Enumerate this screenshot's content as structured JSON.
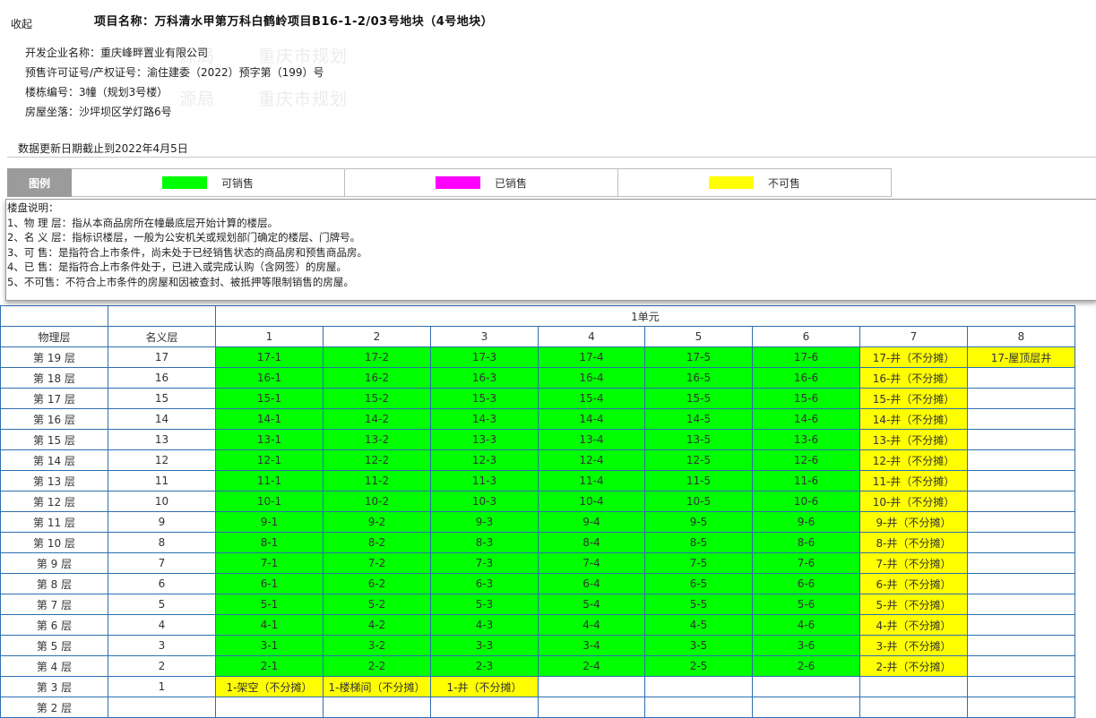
{
  "header": {
    "collapse_label": "收起",
    "project_name": "项目名称：万科清水甲第万科白鹤岭项目B16-1-2/03号地块（4号地块）",
    "developer": "开发企业名称：重庆峰畔置业有限公司",
    "license": "预售许可证号/产权证号：渝住建委（2022）预字第（199）号",
    "building": "楼栋编号：3幢（规划3号楼）",
    "address": "房屋坐落：沙坪坝区学灯路6号",
    "update_date": "数据更新日期截止到2022年4月5日",
    "watermarks": [
      "重庆市规划",
      "源局",
      "重庆市规划"
    ]
  },
  "legend": {
    "title": "图例",
    "items": [
      {
        "label": "可销售",
        "color": "#00ff00"
      },
      {
        "label": "已销售",
        "color": "#ff00ff"
      },
      {
        "label": "不可售",
        "color": "#ffff00"
      }
    ]
  },
  "notes": {
    "title": "楼盘说明：",
    "lines": [
      "1、物 理 层：指从本商品房所在幢最底层开始计算的楼层。",
      "2、名 义 层：指标识楼层，一般为公安机关或规划部门确定的楼层、门牌号。",
      "3、可 售：是指符合上市条件，尚未处于已经销售状态的商品房和预售商品房。",
      "4、已 售：是指符合上市条件处于，已进入或完成认购（含网签）的房屋。",
      "5、不可售：不符合上市条件的房屋和因被查封、被抵押等限制销售的房屋。"
    ]
  },
  "table": {
    "col_physical": "物理层",
    "col_nominal": "名义层",
    "unit_label": "1单元",
    "unit_columns": [
      "1",
      "2",
      "3",
      "4",
      "5",
      "6",
      "7",
      "8"
    ],
    "rows": [
      {
        "physical": "第 19 层",
        "nominal": "17",
        "cells": [
          {
            "label": "17-1",
            "status": "available"
          },
          {
            "label": "17-2",
            "status": "available"
          },
          {
            "label": "17-3",
            "status": "available"
          },
          {
            "label": "17-4",
            "status": "available"
          },
          {
            "label": "17-5",
            "status": "available"
          },
          {
            "label": "17-6",
            "status": "available"
          },
          {
            "label": "17-井（不分摊）",
            "status": "unavailable"
          },
          {
            "label": "17-屋顶层井",
            "status": "unavailable"
          }
        ]
      },
      {
        "physical": "第 18 层",
        "nominal": "16",
        "cells": [
          {
            "label": "16-1",
            "status": "available"
          },
          {
            "label": "16-2",
            "status": "available"
          },
          {
            "label": "16-3",
            "status": "available"
          },
          {
            "label": "16-4",
            "status": "available"
          },
          {
            "label": "16-5",
            "status": "available"
          },
          {
            "label": "16-6",
            "status": "available"
          },
          {
            "label": "16-井（不分摊）",
            "status": "unavailable"
          },
          {
            "label": "",
            "status": "empty"
          }
        ]
      },
      {
        "physical": "第 17 层",
        "nominal": "15",
        "cells": [
          {
            "label": "15-1",
            "status": "available"
          },
          {
            "label": "15-2",
            "status": "available"
          },
          {
            "label": "15-3",
            "status": "available"
          },
          {
            "label": "15-4",
            "status": "available"
          },
          {
            "label": "15-5",
            "status": "available"
          },
          {
            "label": "15-6",
            "status": "available"
          },
          {
            "label": "15-井（不分摊）",
            "status": "unavailable"
          },
          {
            "label": "",
            "status": "empty"
          }
        ]
      },
      {
        "physical": "第 16 层",
        "nominal": "14",
        "cells": [
          {
            "label": "14-1",
            "status": "available"
          },
          {
            "label": "14-2",
            "status": "available"
          },
          {
            "label": "14-3",
            "status": "available"
          },
          {
            "label": "14-4",
            "status": "available"
          },
          {
            "label": "14-5",
            "status": "available"
          },
          {
            "label": "14-6",
            "status": "available"
          },
          {
            "label": "14-井（不分摊）",
            "status": "unavailable"
          },
          {
            "label": "",
            "status": "empty"
          }
        ]
      },
      {
        "physical": "第 15 层",
        "nominal": "13",
        "cells": [
          {
            "label": "13-1",
            "status": "available"
          },
          {
            "label": "13-2",
            "status": "available"
          },
          {
            "label": "13-3",
            "status": "available"
          },
          {
            "label": "13-4",
            "status": "available"
          },
          {
            "label": "13-5",
            "status": "available"
          },
          {
            "label": "13-6",
            "status": "available"
          },
          {
            "label": "13-井（不分摊）",
            "status": "unavailable"
          },
          {
            "label": "",
            "status": "empty"
          }
        ]
      },
      {
        "physical": "第 14 层",
        "nominal": "12",
        "cells": [
          {
            "label": "12-1",
            "status": "available"
          },
          {
            "label": "12-2",
            "status": "available"
          },
          {
            "label": "12-3",
            "status": "available"
          },
          {
            "label": "12-4",
            "status": "available"
          },
          {
            "label": "12-5",
            "status": "available"
          },
          {
            "label": "12-6",
            "status": "available"
          },
          {
            "label": "12-井（不分摊）",
            "status": "unavailable"
          },
          {
            "label": "",
            "status": "empty"
          }
        ]
      },
      {
        "physical": "第 13 层",
        "nominal": "11",
        "cells": [
          {
            "label": "11-1",
            "status": "available"
          },
          {
            "label": "11-2",
            "status": "available"
          },
          {
            "label": "11-3",
            "status": "available"
          },
          {
            "label": "11-4",
            "status": "available"
          },
          {
            "label": "11-5",
            "status": "available"
          },
          {
            "label": "11-6",
            "status": "available"
          },
          {
            "label": "11-井（不分摊）",
            "status": "unavailable"
          },
          {
            "label": "",
            "status": "empty"
          }
        ]
      },
      {
        "physical": "第 12 层",
        "nominal": "10",
        "cells": [
          {
            "label": "10-1",
            "status": "available"
          },
          {
            "label": "10-2",
            "status": "available"
          },
          {
            "label": "10-3",
            "status": "available"
          },
          {
            "label": "10-4",
            "status": "available"
          },
          {
            "label": "10-5",
            "status": "available"
          },
          {
            "label": "10-6",
            "status": "available"
          },
          {
            "label": "10-井（不分摊）",
            "status": "unavailable"
          },
          {
            "label": "",
            "status": "empty"
          }
        ]
      },
      {
        "physical": "第 11 层",
        "nominal": "9",
        "cells": [
          {
            "label": "9-1",
            "status": "available"
          },
          {
            "label": "9-2",
            "status": "available"
          },
          {
            "label": "9-3",
            "status": "available"
          },
          {
            "label": "9-4",
            "status": "available"
          },
          {
            "label": "9-5",
            "status": "available"
          },
          {
            "label": "9-6",
            "status": "available"
          },
          {
            "label": "9-井（不分摊）",
            "status": "unavailable"
          },
          {
            "label": "",
            "status": "empty"
          }
        ]
      },
      {
        "physical": "第 10 层",
        "nominal": "8",
        "cells": [
          {
            "label": "8-1",
            "status": "available"
          },
          {
            "label": "8-2",
            "status": "available"
          },
          {
            "label": "8-3",
            "status": "available"
          },
          {
            "label": "8-4",
            "status": "available"
          },
          {
            "label": "8-5",
            "status": "available"
          },
          {
            "label": "8-6",
            "status": "available"
          },
          {
            "label": "8-井（不分摊）",
            "status": "unavailable"
          },
          {
            "label": "",
            "status": "empty"
          }
        ]
      },
      {
        "physical": "第 9 层",
        "nominal": "7",
        "cells": [
          {
            "label": "7-1",
            "status": "available"
          },
          {
            "label": "7-2",
            "status": "available"
          },
          {
            "label": "7-3",
            "status": "available"
          },
          {
            "label": "7-4",
            "status": "available"
          },
          {
            "label": "7-5",
            "status": "available"
          },
          {
            "label": "7-6",
            "status": "available"
          },
          {
            "label": "7-井（不分摊）",
            "status": "unavailable"
          },
          {
            "label": "",
            "status": "empty"
          }
        ]
      },
      {
        "physical": "第 8 层",
        "nominal": "6",
        "cells": [
          {
            "label": "6-1",
            "status": "available"
          },
          {
            "label": "6-2",
            "status": "available"
          },
          {
            "label": "6-3",
            "status": "available"
          },
          {
            "label": "6-4",
            "status": "available"
          },
          {
            "label": "6-5",
            "status": "available"
          },
          {
            "label": "6-6",
            "status": "available"
          },
          {
            "label": "6-井（不分摊）",
            "status": "unavailable"
          },
          {
            "label": "",
            "status": "empty"
          }
        ]
      },
      {
        "physical": "第 7 层",
        "nominal": "5",
        "cells": [
          {
            "label": "5-1",
            "status": "available"
          },
          {
            "label": "5-2",
            "status": "available"
          },
          {
            "label": "5-3",
            "status": "available"
          },
          {
            "label": "5-4",
            "status": "available"
          },
          {
            "label": "5-5",
            "status": "available"
          },
          {
            "label": "5-6",
            "status": "available"
          },
          {
            "label": "5-井（不分摊）",
            "status": "unavailable"
          },
          {
            "label": "",
            "status": "empty"
          }
        ]
      },
      {
        "physical": "第 6 层",
        "nominal": "4",
        "cells": [
          {
            "label": "4-1",
            "status": "available"
          },
          {
            "label": "4-2",
            "status": "available"
          },
          {
            "label": "4-3",
            "status": "available"
          },
          {
            "label": "4-4",
            "status": "available"
          },
          {
            "label": "4-5",
            "status": "available"
          },
          {
            "label": "4-6",
            "status": "available"
          },
          {
            "label": "4-井（不分摊）",
            "status": "unavailable"
          },
          {
            "label": "",
            "status": "empty"
          }
        ]
      },
      {
        "physical": "第 5 层",
        "nominal": "3",
        "cells": [
          {
            "label": "3-1",
            "status": "available"
          },
          {
            "label": "3-2",
            "status": "available"
          },
          {
            "label": "3-3",
            "status": "available"
          },
          {
            "label": "3-4",
            "status": "available"
          },
          {
            "label": "3-5",
            "status": "available"
          },
          {
            "label": "3-6",
            "status": "available"
          },
          {
            "label": "3-井（不分摊）",
            "status": "unavailable"
          },
          {
            "label": "",
            "status": "empty"
          }
        ]
      },
      {
        "physical": "第 4 层",
        "nominal": "2",
        "cells": [
          {
            "label": "2-1",
            "status": "available"
          },
          {
            "label": "2-2",
            "status": "available"
          },
          {
            "label": "2-3",
            "status": "available"
          },
          {
            "label": "2-4",
            "status": "available"
          },
          {
            "label": "2-5",
            "status": "available"
          },
          {
            "label": "2-6",
            "status": "available"
          },
          {
            "label": "2-井（不分摊）",
            "status": "unavailable"
          },
          {
            "label": "",
            "status": "empty"
          }
        ]
      },
      {
        "physical": "第 3 层",
        "nominal": "1",
        "cells": [
          {
            "label": "1-架空（不分摊）",
            "status": "unavailable"
          },
          {
            "label": "1-楼梯间（不分摊）",
            "status": "unavailable"
          },
          {
            "label": "1-井（不分摊）",
            "status": "unavailable"
          },
          {
            "label": "",
            "status": "empty"
          },
          {
            "label": "",
            "status": "empty"
          },
          {
            "label": "",
            "status": "empty"
          },
          {
            "label": "",
            "status": "empty"
          },
          {
            "label": "",
            "status": "empty"
          }
        ]
      },
      {
        "physical": "第 2 层",
        "nominal": "",
        "cells": [
          {
            "label": "",
            "status": "empty"
          },
          {
            "label": "",
            "status": "empty"
          },
          {
            "label": "",
            "status": "empty"
          },
          {
            "label": "",
            "status": "empty"
          },
          {
            "label": "",
            "status": "empty"
          },
          {
            "label": "",
            "status": "empty"
          },
          {
            "label": "",
            "status": "empty"
          },
          {
            "label": "",
            "status": "empty"
          }
        ]
      }
    ]
  }
}
